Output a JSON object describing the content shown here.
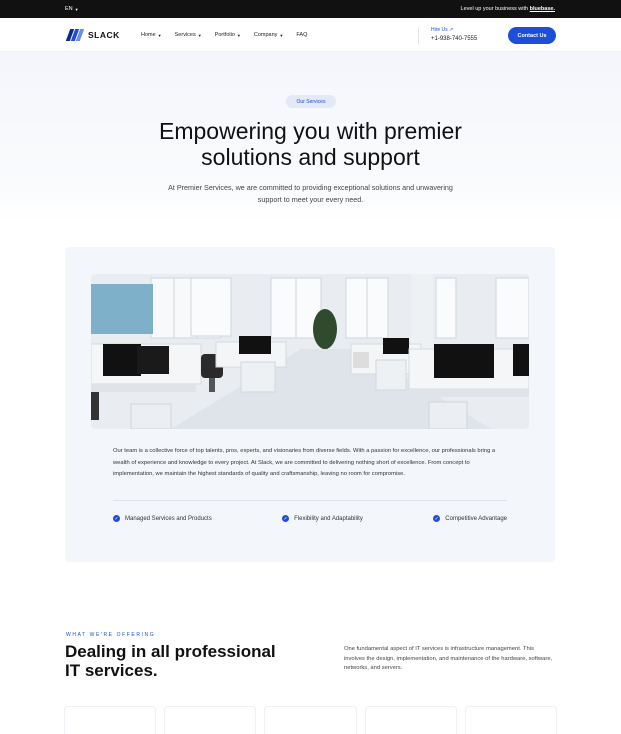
{
  "topbar": {
    "language": "EN",
    "announcement_prefix": "Level up your business with",
    "announcement_link": "bluebase."
  },
  "header": {
    "brand": "SLACK",
    "nav": [
      {
        "label": "Home",
        "has_dropdown": true
      },
      {
        "label": "Services",
        "has_dropdown": true
      },
      {
        "label": "Portfolio",
        "has_dropdown": true
      },
      {
        "label": "Company",
        "has_dropdown": true
      },
      {
        "label": "FAQ",
        "has_dropdown": false
      }
    ],
    "hire_label": "Hire Us ↗",
    "phone": "+1-938-740-7555",
    "contact_button": "Contact Us",
    "accent_color": "#1d4ed8"
  },
  "hero": {
    "badge": "Our Services",
    "title_line1": "Empowering you with premier",
    "title_line2": "solutions and support",
    "subtitle": "At Premier Services, we are committed to providing exceptional solutions and unwavering support to meet your every need."
  },
  "about": {
    "body": "Our team is a collective force of top talents, pros, experts, and visionaries from diverse fields. With a passion for excellence, our professionals bring a wealth of experience and knowledge to every project. At Slack, we are committed to delivering nothing short of excellence. From concept to implementation, we maintain the highest standards of quality and craftsmanship, leaving no room for compromise.",
    "features": [
      {
        "label": "Managed Services and Products",
        "icon": "check-circle-icon"
      },
      {
        "label": "Flexibility and Adaptability",
        "icon": "check-circle-icon"
      },
      {
        "label": "Competitive Advantage",
        "icon": "check-circle-icon"
      }
    ]
  },
  "offering": {
    "eyebrow": "WHAT WE'RE OFFERING",
    "title_line1": "Dealing in all professional",
    "title_line2": "IT services.",
    "description": "One fundamental aspect of IT services is infrastructure management. This involves the design, implementation, and maintenance of the hardware, software, networks, and servers."
  }
}
